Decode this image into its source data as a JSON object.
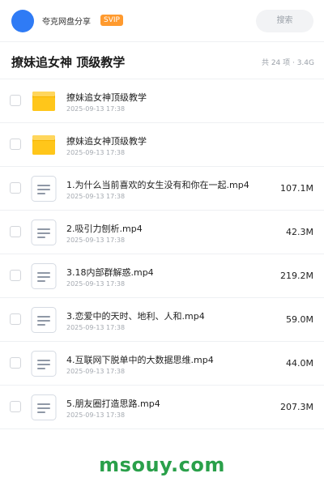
{
  "header": {
    "app_name": "夸克网盘分享",
    "badge": "SVIP",
    "search_label": "搜索"
  },
  "folder": {
    "title": "撩妹追女神 顶级教学",
    "meta": "共 24 项 · 3.4G"
  },
  "files": [
    {
      "type": "folder",
      "name": "撩妹追女神顶级教学",
      "date": "2025-09-13 17:38",
      "size": ""
    },
    {
      "type": "folder",
      "name": "撩妹追女神顶级教学",
      "date": "2025-09-13 17:38",
      "size": ""
    },
    {
      "type": "file",
      "name": "1.为什么当前喜欢的女生没有和你在一起.mp4",
      "date": "2025-09-13 17:38",
      "size": "107.1M"
    },
    {
      "type": "file",
      "name": "2.吸引力刨析.mp4",
      "date": "2025-09-13 17:38",
      "size": "42.3M"
    },
    {
      "type": "file",
      "name": "3.18内部群解惑.mp4",
      "date": "2025-09-13 17:38",
      "size": "219.2M"
    },
    {
      "type": "file",
      "name": "3.恋爱中的天时、地利、人和.mp4",
      "date": "2025-09-13 17:38",
      "size": "59.0M"
    },
    {
      "type": "file",
      "name": "4.互联网下脱单中的大数据思维.mp4",
      "date": "2025-09-13 17:38",
      "size": "44.0M"
    },
    {
      "type": "file",
      "name": "5.朋友圈打造思路.mp4",
      "date": "2025-09-13 17:38",
      "size": "207.3M"
    }
  ],
  "watermark": "msouy.com"
}
